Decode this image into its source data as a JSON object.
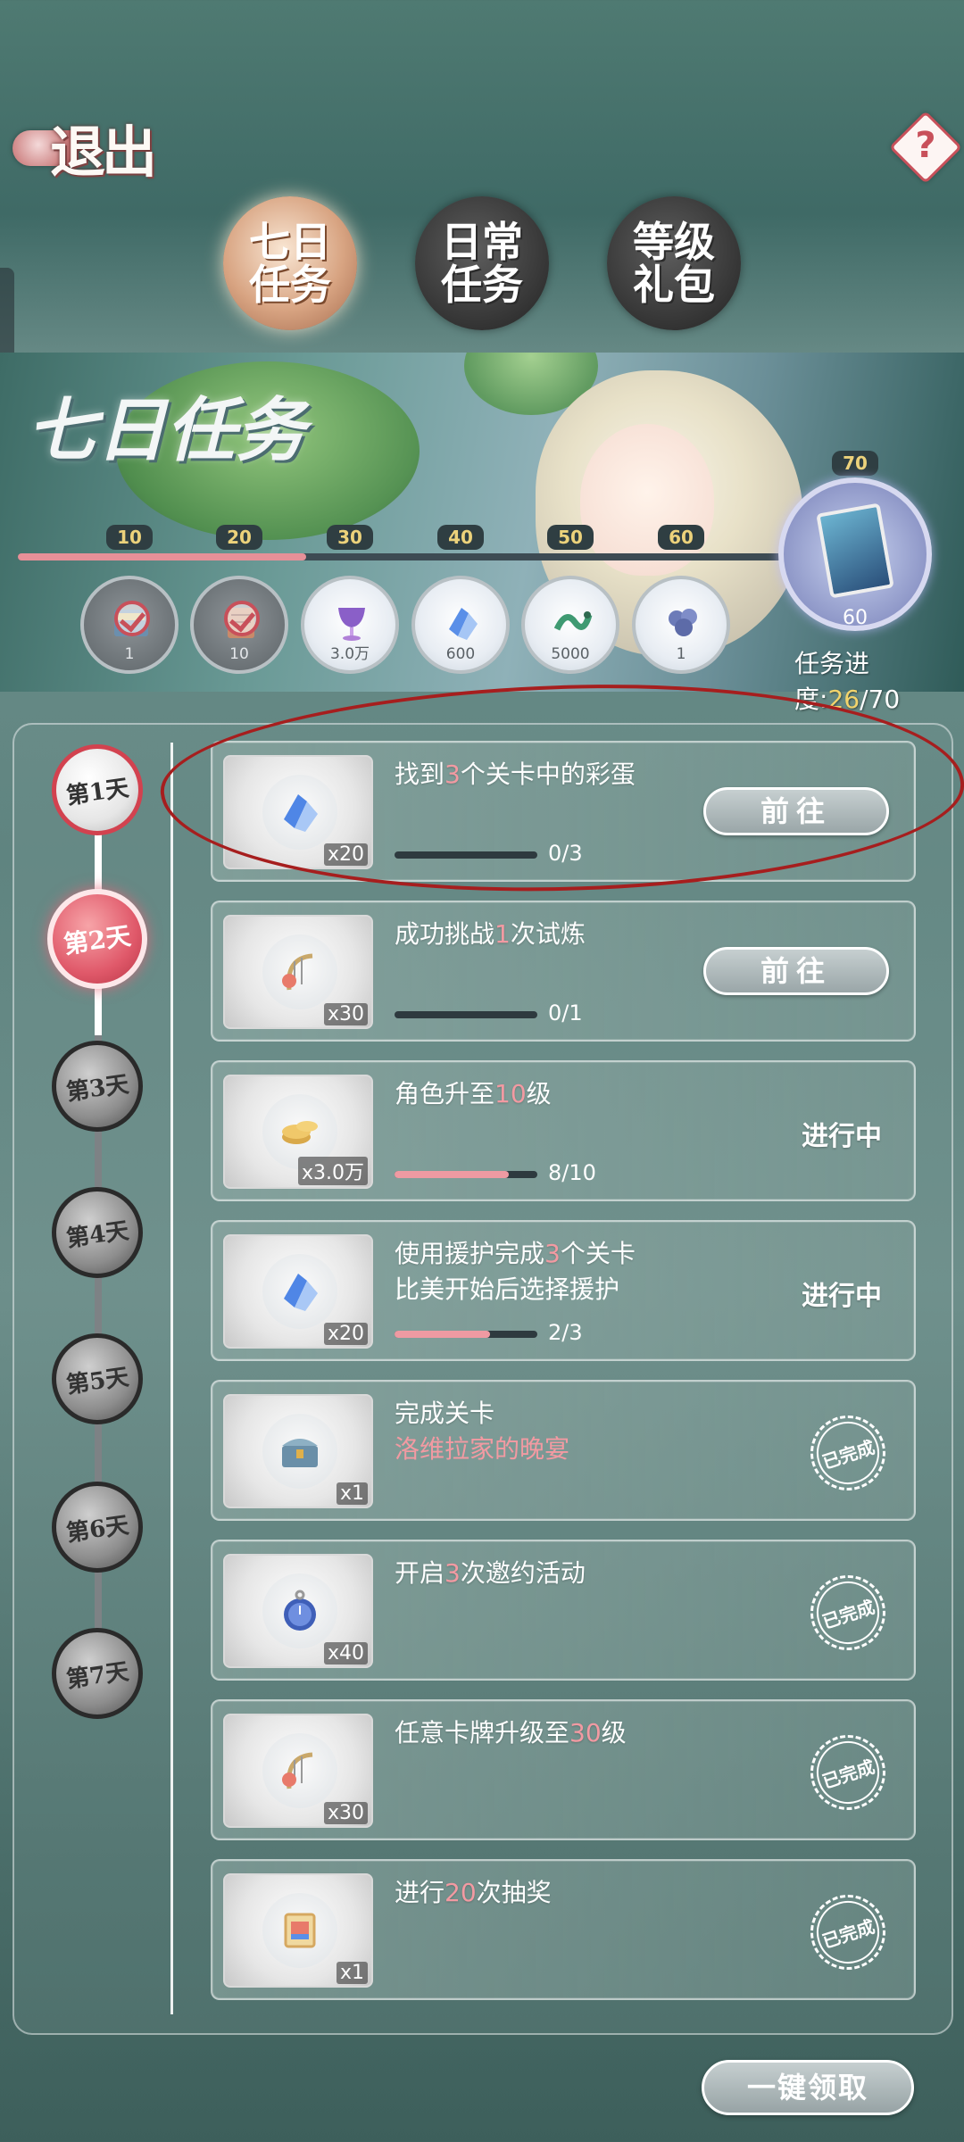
{
  "header": {
    "exit_label": "退出",
    "help_symbol": "?",
    "tabs": [
      {
        "label": "七日任务",
        "active": true
      },
      {
        "label": "日常任务",
        "active": false
      },
      {
        "label": "等级礼包",
        "active": false
      }
    ]
  },
  "banner": {
    "title": "七日任务",
    "progress": {
      "current": 26,
      "max": 70,
      "label_prefix": "任务进度:",
      "current_text": "26",
      "max_text": "/70"
    },
    "milestones": [
      {
        "value": "10",
        "reward_count": "1",
        "icon": "card-pack-icon",
        "claimed": true
      },
      {
        "value": "20",
        "reward_count": "10",
        "icon": "scroll-icon",
        "claimed": true
      },
      {
        "value": "30",
        "reward_count": "3.0万",
        "icon": "purple-goblet-icon",
        "claimed": false
      },
      {
        "value": "40",
        "reward_count": "600",
        "icon": "blue-crystal-ticket-icon",
        "claimed": false
      },
      {
        "value": "50",
        "reward_count": "5000",
        "icon": "green-serpent-icon",
        "claimed": false
      },
      {
        "value": "60",
        "reward_count": "1",
        "icon": "blue-bouquet-icon",
        "claimed": false
      }
    ],
    "final_reward": {
      "value": "70",
      "count": "60",
      "icon": "character-card-icon"
    }
  },
  "days": [
    {
      "label": "第1天",
      "state": "done"
    },
    {
      "label": "第2天",
      "state": "current"
    },
    {
      "label": "第3天",
      "state": "locked"
    },
    {
      "label": "第4天",
      "state": "locked"
    },
    {
      "label": "第5天",
      "state": "locked"
    },
    {
      "label": "第6天",
      "state": "locked"
    },
    {
      "label": "第7天",
      "state": "locked"
    }
  ],
  "tasks": [
    {
      "pre": "找到",
      "num": "3",
      "post": "个关卡中的彩蛋",
      "line2": "",
      "qty": "x20",
      "icon": "blue-crystal-ticket-icon",
      "progress_text": "0/3",
      "progress": 0.0,
      "status": "go",
      "go_label": "前往"
    },
    {
      "pre": "成功挑战",
      "num": "1",
      "post": "次试炼",
      "line2": "",
      "qty": "x30",
      "icon": "harp-rose-icon",
      "progress_text": "0/1",
      "progress": 0.0,
      "status": "go",
      "go_label": "前往"
    },
    {
      "pre": "角色升至",
      "num": "10",
      "post": "级",
      "line2": "",
      "qty": "x3.0万",
      "icon": "gold-coins-icon",
      "progress_text": "8/10",
      "progress": 0.8,
      "status": "ongoing",
      "status_label": "进行中"
    },
    {
      "pre": "使用援护完成",
      "num": "3",
      "post": "个关卡",
      "line2": "比美开始后选择援护",
      "qty": "x20",
      "icon": "blue-crystal-ticket-icon",
      "progress_text": "2/3",
      "progress": 0.667,
      "status": "ongoing",
      "status_label": "进行中"
    },
    {
      "pre": "完成关卡",
      "num": "",
      "post": "",
      "line2_red": "洛维拉家的晚宴",
      "qty": "x1",
      "icon": "treasure-chest-icon",
      "status": "completed",
      "status_label": "已完成"
    },
    {
      "pre": "开启",
      "num": "3",
      "post": "次邀约活动",
      "line2": "",
      "qty": "x40",
      "icon": "pocket-watch-icon",
      "status": "completed",
      "status_label": "已完成"
    },
    {
      "pre": "任意卡牌升级至",
      "num": "30",
      "post": "级",
      "line2": "",
      "qty": "x30",
      "icon": "harp-rose-icon",
      "status": "completed",
      "status_label": "已完成"
    },
    {
      "pre": "进行",
      "num": "20",
      "post": "次抽奖",
      "line2": "",
      "qty": "x1",
      "icon": "stamp-ticket-icon",
      "status": "completed",
      "status_label": "已完成"
    }
  ],
  "footer": {
    "claim_all_label": "一键领取"
  },
  "colors": {
    "accent_pink": "#f29aa2",
    "progress_yellow": "#f2d46c",
    "annotation_red": "#a61e1e"
  }
}
